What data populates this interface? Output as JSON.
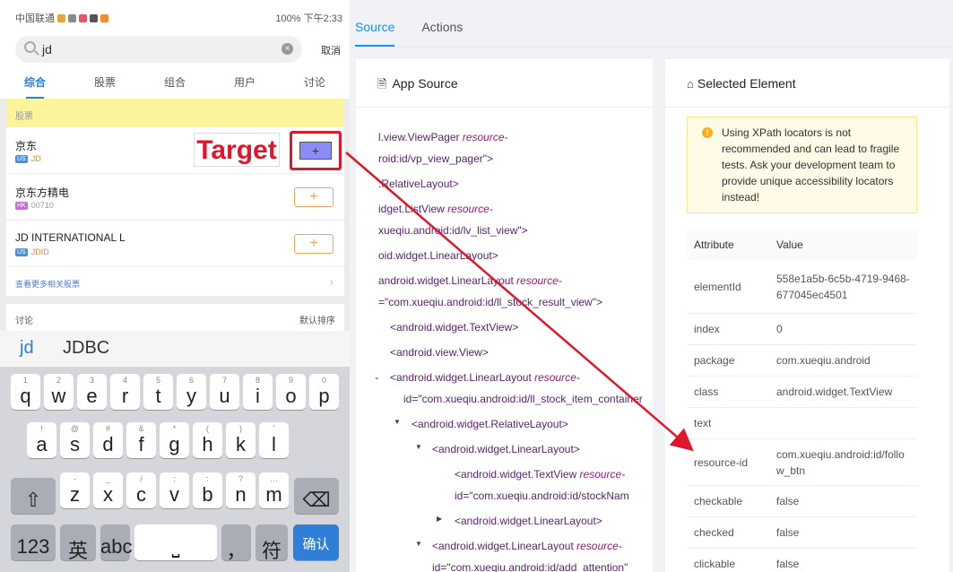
{
  "phone": {
    "status_left": "中国联通",
    "status_right": "100% 下午2:33",
    "search_query": "jd",
    "search_cancel": "取消",
    "tabs": [
      "综合",
      "股票",
      "组合",
      "用户",
      "讨论"
    ],
    "section_banner": "股票",
    "stocks": [
      {
        "name": "京东",
        "market": "US",
        "code": "JD",
        "market_color": "#4a90e2"
      },
      {
        "name": "京东方精电",
        "market": "HK",
        "code": "00710",
        "market_color": "#c86dd7"
      },
      {
        "name": "JD INTERNATIONAL L",
        "market": "US",
        "code": "JDID",
        "market_color": "#4a90e2"
      }
    ],
    "add_label": "+",
    "more_link": "查看更多相关股票",
    "target_label": "Target",
    "discuss_label": "讨论",
    "sort_label": "默认排序",
    "suggestions": [
      "jd",
      "JDBC"
    ],
    "keyboard": {
      "row1": [
        [
          "1",
          "q"
        ],
        [
          "2",
          "w"
        ],
        [
          "3",
          "e"
        ],
        [
          "4",
          "r"
        ],
        [
          "5",
          "t"
        ],
        [
          "6",
          "y"
        ],
        [
          "7",
          "u"
        ],
        [
          "8",
          "i"
        ],
        [
          "9",
          "o"
        ],
        [
          "0",
          "p"
        ]
      ],
      "row2": [
        [
          "!",
          "a"
        ],
        [
          "@",
          "s"
        ],
        [
          "#",
          "d"
        ],
        [
          "&",
          "f"
        ],
        [
          "*",
          "g"
        ],
        [
          "(",
          "h"
        ],
        [
          ")",
          "k"
        ],
        [
          "'",
          "l"
        ]
      ],
      "row3": [
        [
          "-",
          "z"
        ],
        [
          "_",
          "x"
        ],
        [
          "/",
          "c"
        ],
        [
          ";",
          "v"
        ],
        [
          ":",
          "b"
        ],
        [
          "?",
          "n"
        ],
        [
          "…",
          "m"
        ]
      ],
      "key_123": "123",
      "key_lang": "英",
      "key_lang_sub": "中",
      "key_abc": "abc",
      "key_comma": "，",
      "key_comma_sub": "。",
      "key_fu": "符",
      "key_confirm": "确认"
    }
  },
  "nav": {
    "tab_source": "Source",
    "tab_actions": "Actions"
  },
  "source": {
    "title": "App Source",
    "lines": [
      {
        "t": "l.view.ViewPager ",
        "a": "resource-"
      },
      {
        "t": "roid:id/vp_view_pager\">"
      },
      {
        "t": ".RelativeLayout>"
      },
      {
        "t": "idget.ListView ",
        "a": "resource-"
      },
      {
        "t": "xueqiu.android:id/lv_list_view\">"
      },
      {
        "t": "oid.widget.LinearLayout>"
      },
      {
        "t": "android.widget.LinearLayout ",
        "a": "resource-"
      },
      {
        "t": "=\"com.xueqiu.android:id/ll_stock_result_view\">"
      },
      {
        "t": "<android.widget.TextView>"
      },
      {
        "t": "<android.view.View>"
      },
      {
        "t": "<android.widget.LinearLayout ",
        "a": "resource-"
      },
      {
        "t": "id=\"com.xueqiu.android:id/ll_stock_item_container"
      },
      {
        "t": "<android.widget.RelativeLayout>"
      },
      {
        "t": "<android.widget.LinearLayout>"
      },
      {
        "t": "<android.widget.TextView ",
        "a": "resource-"
      },
      {
        "t": "id=\"com.xueqiu.android:id/stockNam"
      },
      {
        "t": "<android.widget.LinearLayout>"
      },
      {
        "t": "<android.widget.LinearLayout ",
        "a": "resource-"
      },
      {
        "t": "id=\"com.xueqiu.android:id/add_attention\""
      }
    ]
  },
  "selected": {
    "title": "Selected Element",
    "warning": "Using XPath locators is not recommended and can lead to fragile tests. Ask your development team to provide unique accessibility locators instead!",
    "col_attr": "Attribute",
    "col_value": "Value",
    "rows": [
      {
        "k": "elementId",
        "v": "558e1a5b-6c5b-4719-9468-677045ec4501"
      },
      {
        "k": "index",
        "v": "0"
      },
      {
        "k": "package",
        "v": "com.xueqiu.android"
      },
      {
        "k": "class",
        "v": "android.widget.TextView"
      },
      {
        "k": "text",
        "v": ""
      },
      {
        "k": "resource-id",
        "v": "com.xueqiu.android:id/follow_btn"
      },
      {
        "k": "checkable",
        "v": "false"
      },
      {
        "k": "checked",
        "v": "false"
      },
      {
        "k": "clickable",
        "v": "false"
      }
    ]
  },
  "colors": {
    "accent": "#1890ff",
    "target_red": "#e0172a",
    "warn_bg": "#fffbe6"
  }
}
